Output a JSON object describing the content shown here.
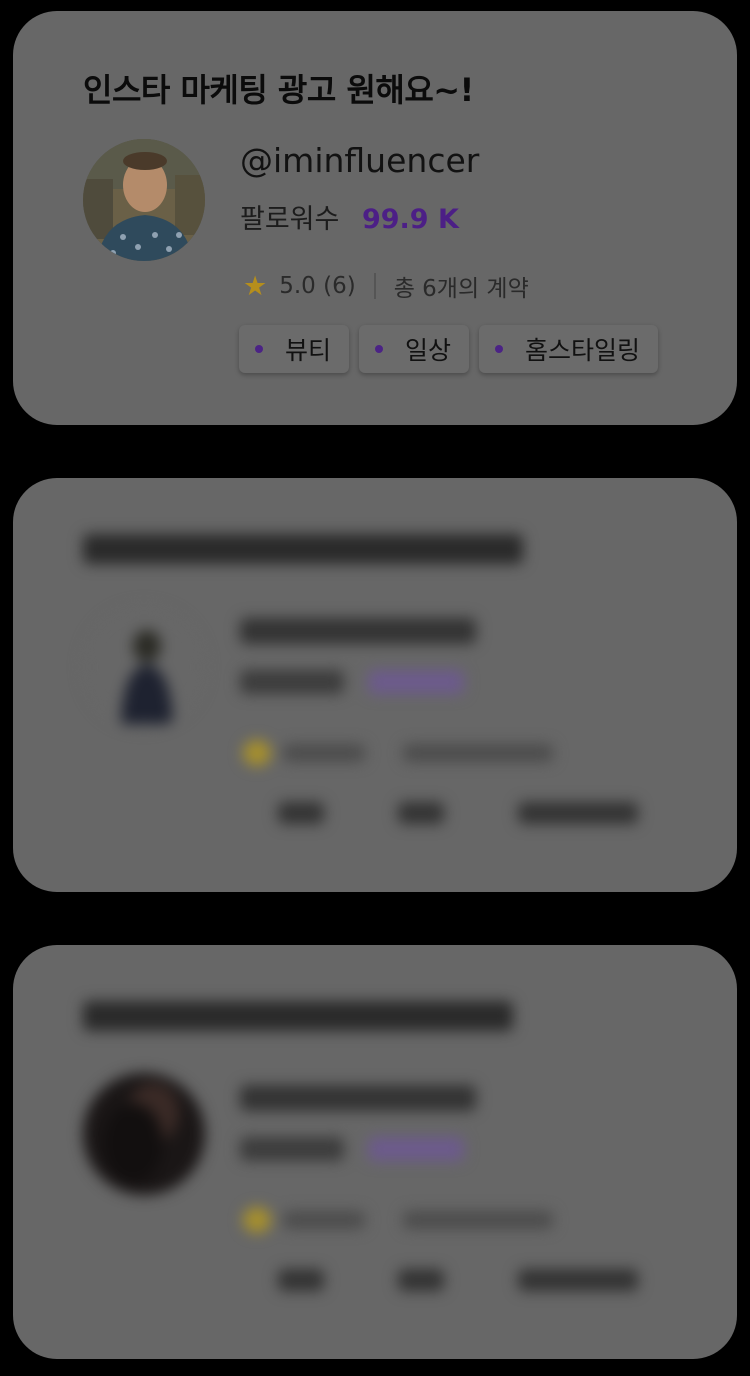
{
  "cards": [
    {
      "title": "인스타 마케팅 광고 원해요~!",
      "handle": "@iminfluencer",
      "followers_label": "팔로워수",
      "followers_count": "99.9 K",
      "rating": "5.0 (6)",
      "contracts": "총 6개의 계약",
      "tags": [
        "뷰티",
        "일상",
        "홈스타일링"
      ]
    },
    {
      "title": "",
      "handle": "",
      "followers_label": "",
      "followers_count": "",
      "rating": "",
      "contracts": "",
      "tags": [
        "",
        "",
        ""
      ]
    },
    {
      "title": "",
      "handle": "",
      "followers_label": "",
      "followers_count": "",
      "rating": "",
      "contracts": "",
      "tags": [
        "",
        "",
        ""
      ]
    }
  ],
  "icons": {
    "rating": "star-icon",
    "tag_bullet": "dot-icon"
  },
  "colors": {
    "accent": "#4c1f86",
    "star": "#b58e1c",
    "overlay": "#000000"
  }
}
